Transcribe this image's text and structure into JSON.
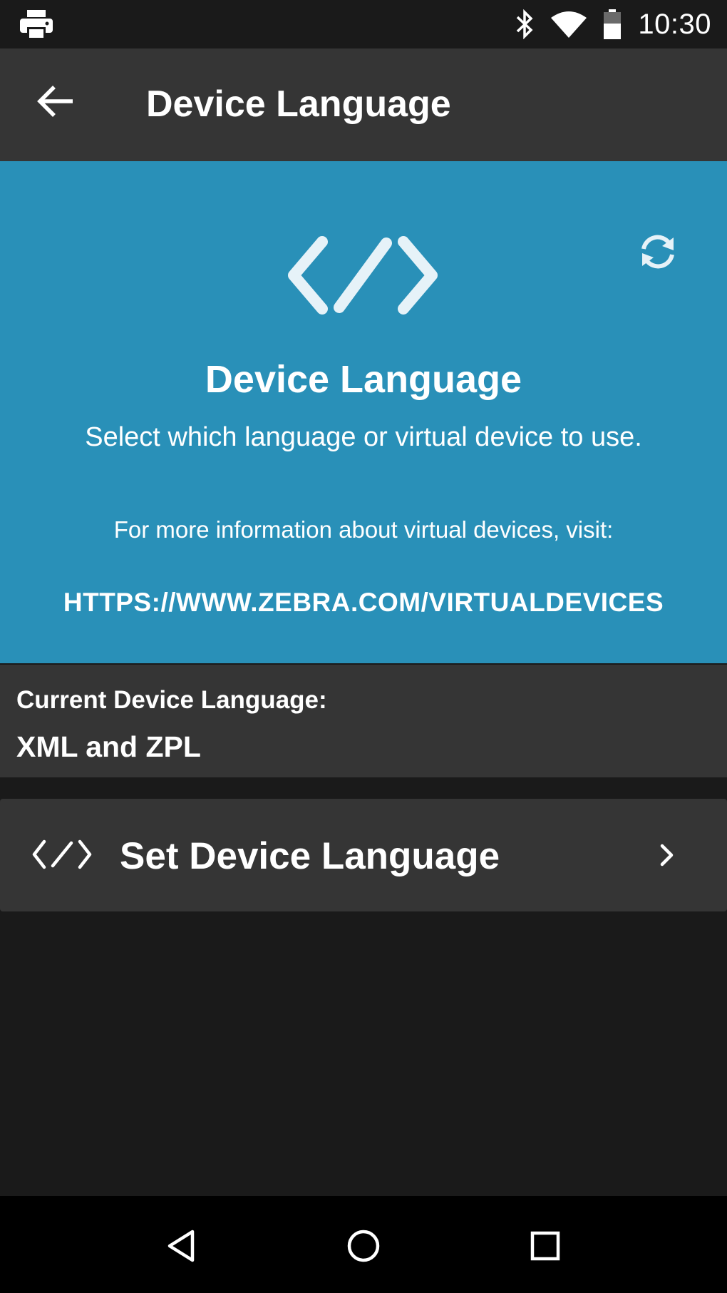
{
  "status_bar": {
    "left_icon": "printer-icon",
    "icons": [
      "bluetooth-icon",
      "wifi-icon",
      "battery-icon"
    ],
    "time": "10:30"
  },
  "app_bar": {
    "back_icon": "arrow-left-icon",
    "title": "Device Language"
  },
  "hero": {
    "icon": "code-icon",
    "refresh_icon": "refresh-icon",
    "title": "Device Language",
    "description": "Select which language or virtual device to use.",
    "info": "For more information about virtual devices, visit:",
    "link": "HTTPS://WWW.ZEBRA.COM/VIRTUALDEVICES",
    "background_color": "#2990b8"
  },
  "current": {
    "label": "Current Device Language:",
    "value": "XML and ZPL"
  },
  "set_language": {
    "icon": "code-icon",
    "label": "Set Device Language",
    "chevron_icon": "chevron-right-icon"
  },
  "nav_bar": {
    "buttons": [
      "back-triangle-icon",
      "home-circle-icon",
      "recents-square-icon"
    ]
  }
}
